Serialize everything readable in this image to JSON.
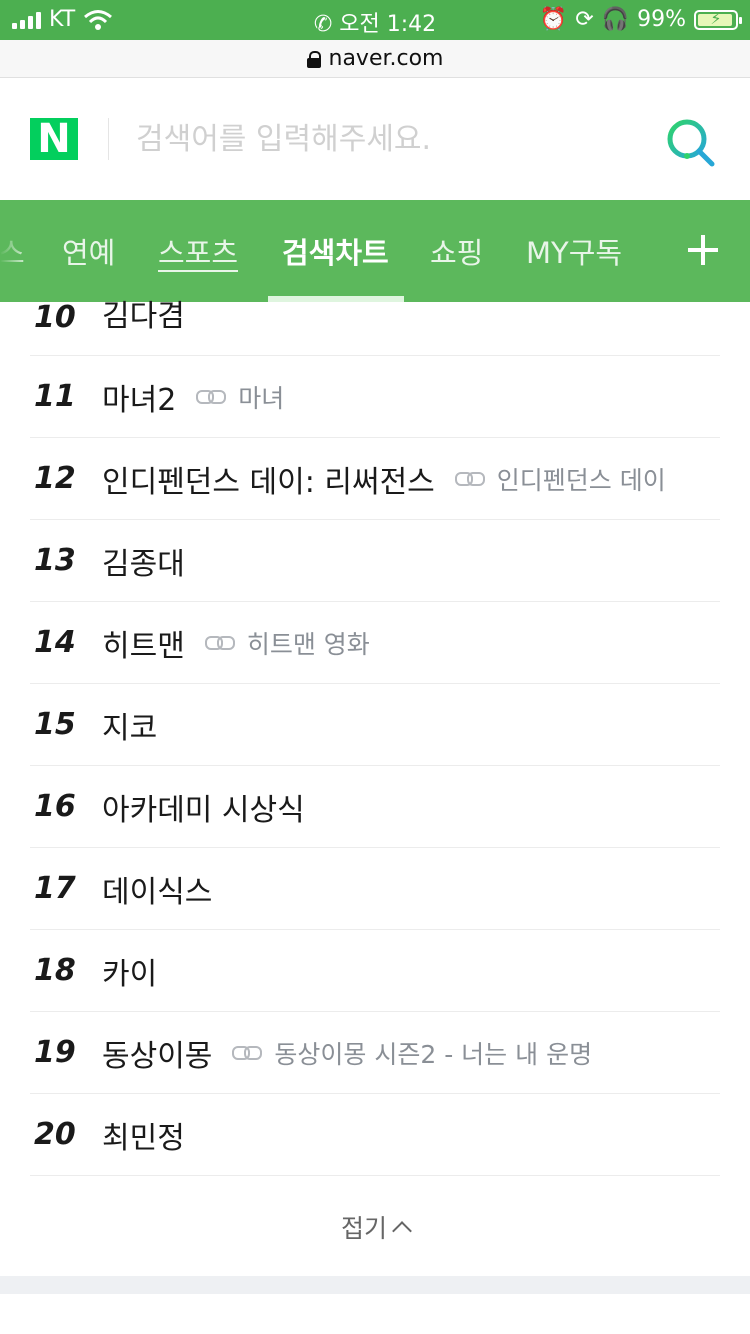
{
  "status_bar": {
    "carrier": "KT",
    "time": "오전 1:42",
    "battery_percent": "99%"
  },
  "url_bar": {
    "domain": "naver.com"
  },
  "search": {
    "logo": "N",
    "placeholder": "검색어를 입력해주세요."
  },
  "tabs": [
    {
      "label": "스"
    },
    {
      "label": "연예"
    },
    {
      "label": "스포츠"
    },
    {
      "label": "검색차트",
      "active": true
    },
    {
      "label": "쇼핑"
    },
    {
      "label": "MY구독"
    }
  ],
  "chart": [
    {
      "rank": "10",
      "keyword": "김다겸"
    },
    {
      "rank": "11",
      "keyword": "마녀2",
      "related": "마녀"
    },
    {
      "rank": "12",
      "keyword": "인디펜던스 데이: 리써전스",
      "related": "인디펜던스 데이"
    },
    {
      "rank": "13",
      "keyword": "김종대"
    },
    {
      "rank": "14",
      "keyword": "히트맨",
      "related": "히트맨 영화"
    },
    {
      "rank": "15",
      "keyword": "지코"
    },
    {
      "rank": "16",
      "keyword": "아카데미 시상식"
    },
    {
      "rank": "17",
      "keyword": "데이식스"
    },
    {
      "rank": "18",
      "keyword": "카이"
    },
    {
      "rank": "19",
      "keyword": "동상이몽",
      "related": "동상이몽 시즌2 - 너는 내 운명"
    },
    {
      "rank": "20",
      "keyword": "최민정"
    }
  ],
  "collapse_label": "접기",
  "colors": {
    "brand_green": "#03cf5d",
    "tab_bar": "#5cb85c",
    "status_bar": "#4caf50"
  }
}
